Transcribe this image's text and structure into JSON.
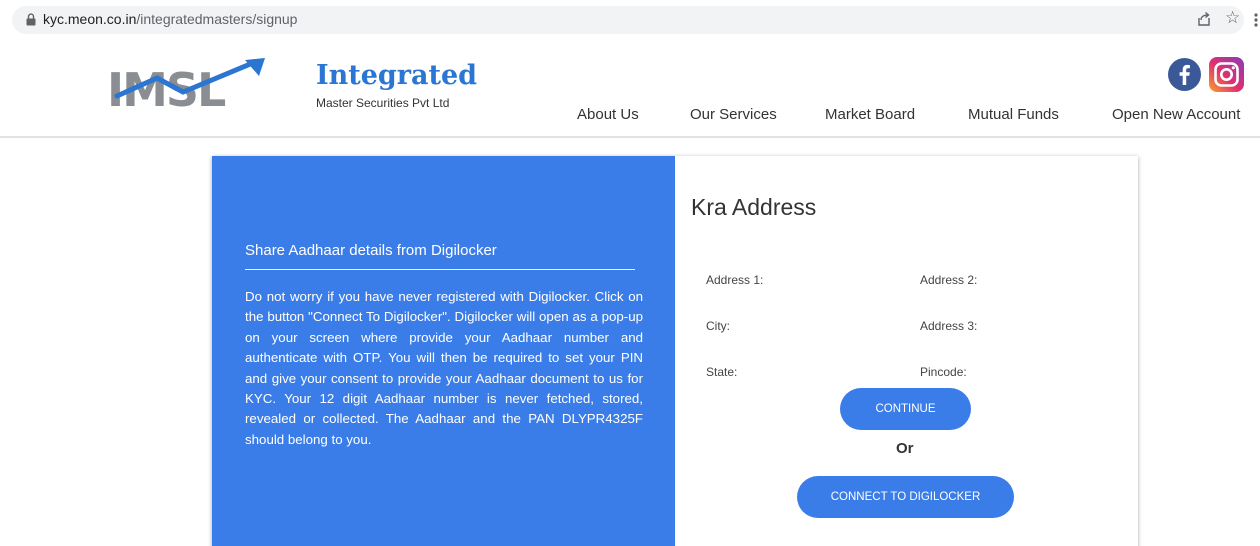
{
  "browser": {
    "url_domain": "kyc.meon.co.in",
    "url_path": "/integratedmasters/signup",
    "icons": [
      "lock-icon",
      "share-icon",
      "star-icon",
      "more-icon"
    ]
  },
  "header": {
    "logo_text": "IMSL",
    "brand_title": "Integrated",
    "brand_subtitle": "Master Securities Pvt Ltd",
    "nav": [
      {
        "label": "About Us"
      },
      {
        "label": "Our Services"
      },
      {
        "label": "Market Board"
      },
      {
        "label": "Mutual Funds"
      },
      {
        "label": "Open New Account"
      }
    ],
    "social_icons": [
      "facebook-icon",
      "instagram-icon"
    ]
  },
  "left_panel": {
    "title": "Share Aadhaar details from Digilocker",
    "body": "Do not worry if you have never registered with Digilocker. Click on the button \"Connect To Digilocker\". Digilocker will open as a pop-up on your screen where provide your Aadhaar number and authenticate with OTP. You will then be required to set your PIN and give your consent to provide your Aadhaar document to us for KYC. Your 12 digit Aadhaar number is never fetched, stored, revealed or collected. The Aadhaar and the PAN DLYPR4325F should belong to you."
  },
  "right_panel": {
    "title": "Kra Address",
    "fields": {
      "address1": "Address 1:",
      "address2": "Address 2:",
      "city": "City:",
      "address3": "Address 3:",
      "state": "State:",
      "pincode": "Pincode:"
    },
    "continue_label": "CONTINUE",
    "or_label": "Or",
    "digilocker_label": "CONNECT TO DIGILOCKER"
  },
  "colors": {
    "accent_blue": "#3a7de8",
    "brand_blue": "#2a76d2",
    "facebook": "#3b5998"
  }
}
